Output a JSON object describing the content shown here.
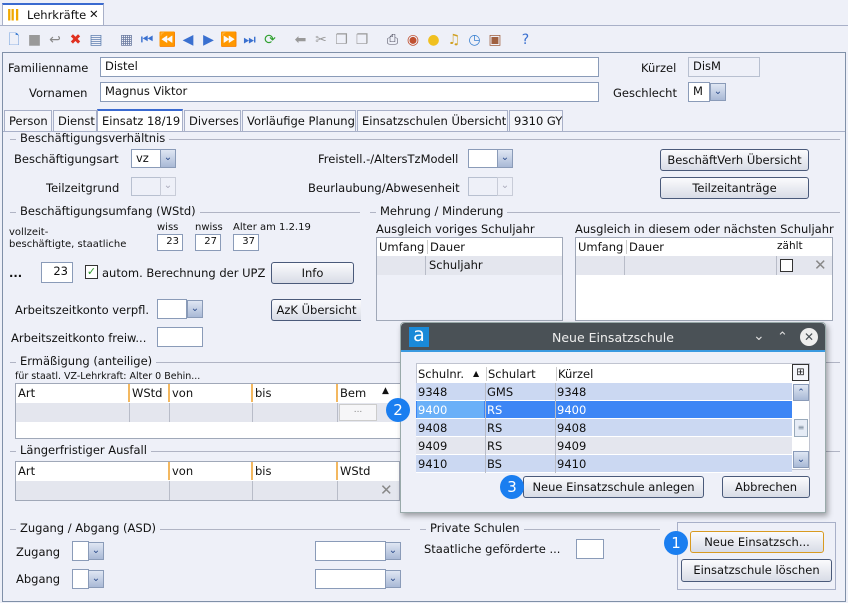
{
  "window_tab": {
    "label": "Lehrkräfte",
    "close": "✕"
  },
  "toolbar": {
    "icons": [
      "new-icon",
      "save-icon",
      "undo-icon",
      "delete-icon",
      "remove-icon",
      "list-icon",
      "first-icon",
      "prev-page-icon",
      "prev-icon",
      "next-icon",
      "next-page-icon",
      "last-icon",
      "refresh-icon",
      "back-arrow-icon",
      "cut-icon",
      "copy-icon",
      "paste-icon",
      "print-icon",
      "view-icon",
      "idea-icon",
      "bell-icon",
      "alarm-icon",
      "contact-icon",
      "help-icon"
    ]
  },
  "person": {
    "familienname_label": "Familienname",
    "familienname": "Distel",
    "vornamen_label": "Vornamen",
    "vornamen": "Magnus Viktor",
    "kuerzel_label": "Kürzel",
    "kuerzel": "DisM",
    "geschlecht_label": "Geschlecht",
    "geschlecht": "M"
  },
  "tabs": [
    {
      "label": "Person"
    },
    {
      "label": "Dienst"
    },
    {
      "label": "Einsatz 18/19"
    },
    {
      "label": "Diverses"
    },
    {
      "label": "Vorläufige Planung"
    },
    {
      "label": "Einsatzschulen Übersicht"
    },
    {
      "label": "9310 GY"
    }
  ],
  "beschaeftigung": {
    "title": "Beschäftigungsverhältnis",
    "art_label": "Beschäftigungsart",
    "art": "vz",
    "teilzeit_label": "Teilzeitgrund",
    "freistell_label": "Freistell.-/AltersTzModell",
    "beurlaubung_label": "Beurlaubung/Abwesenheit",
    "btn_uebersicht": "BeschäftVerh Übersicht",
    "btn_teilzeit": "Teilzeitanträge"
  },
  "umfang": {
    "title": "Beschäftigungsumfang (WStd)",
    "vz_line1": "vollzeit-",
    "vz_line2": "beschäftigte, staatliche",
    "wiss_label": "wiss",
    "wiss": "23",
    "nwiss_label": "nwiss",
    "nwiss": "27",
    "alter_label": "Alter am 1.2.19",
    "alter": "37",
    "dots": "...",
    "upz": "23",
    "auto_label": "autom. Berechnung der UPZ",
    "auto_checked": true,
    "info": "Info",
    "azk_verpfl_label": "Arbeitszeitkonto verpfl.",
    "azk_btn": "AzK Übersicht",
    "azk_freiw_label": "Arbeitszeitkonto freiw..."
  },
  "mehrung": {
    "title": "Mehrung / Minderung",
    "vorjahr_label": "Ausgleich voriges Schuljahr",
    "vorjahr_cols": [
      "Umfang",
      "Dauer"
    ],
    "vorjahr_row": [
      "",
      "Schuljahr"
    ],
    "aktuell_label": "Ausgleich in diesem oder nächsten Schuljahr",
    "aktuell_cols": [
      "Umfang",
      "Dauer",
      "zählt"
    ]
  },
  "ermaessigung": {
    "title": "Ermäßigung (anteilige)",
    "hint": "für staatl. VZ-Lehrkraft: Alter 0 Behin...",
    "cols": [
      "Art",
      "WStd",
      "von",
      "bis",
      "Bem"
    ],
    "bem_btn": "..."
  },
  "ausfall": {
    "title": "Längerfristiger Ausfall",
    "cols": [
      "Art",
      "von",
      "bis",
      "WStd"
    ]
  },
  "zugang": {
    "title": "Zugang / Abgang (ASD)",
    "zugang_label": "Zugang",
    "abgang_label": "Abgang"
  },
  "private": {
    "title": "Private Schulen",
    "label": "Staatliche geförderte ..."
  },
  "actions": {
    "neu": "Neue Einsatzsch...",
    "loeschen": "Einsatzschule löschen"
  },
  "dialog": {
    "title": "Neue Einsatzschule",
    "logo": "a",
    "cols": [
      "Schulnr.",
      "Schulart",
      "Kürzel"
    ],
    "rows": [
      [
        "9348",
        "GMS",
        "9348"
      ],
      [
        "9400",
        "RS",
        "9400"
      ],
      [
        "9408",
        "RS",
        "9408"
      ],
      [
        "9409",
        "RS",
        "9409"
      ],
      [
        "9410",
        "BS",
        "9410"
      ]
    ],
    "selected_row": 1,
    "btn_anlegen": "Neue Einsatzschule anlegen",
    "btn_abbrechen": "Abbrechen"
  },
  "badges": [
    "1",
    "2",
    "3"
  ],
  "colors": {
    "accent": "#1a7ef0",
    "selection": "#3d86f5",
    "dialog_title": "#4a5156"
  }
}
